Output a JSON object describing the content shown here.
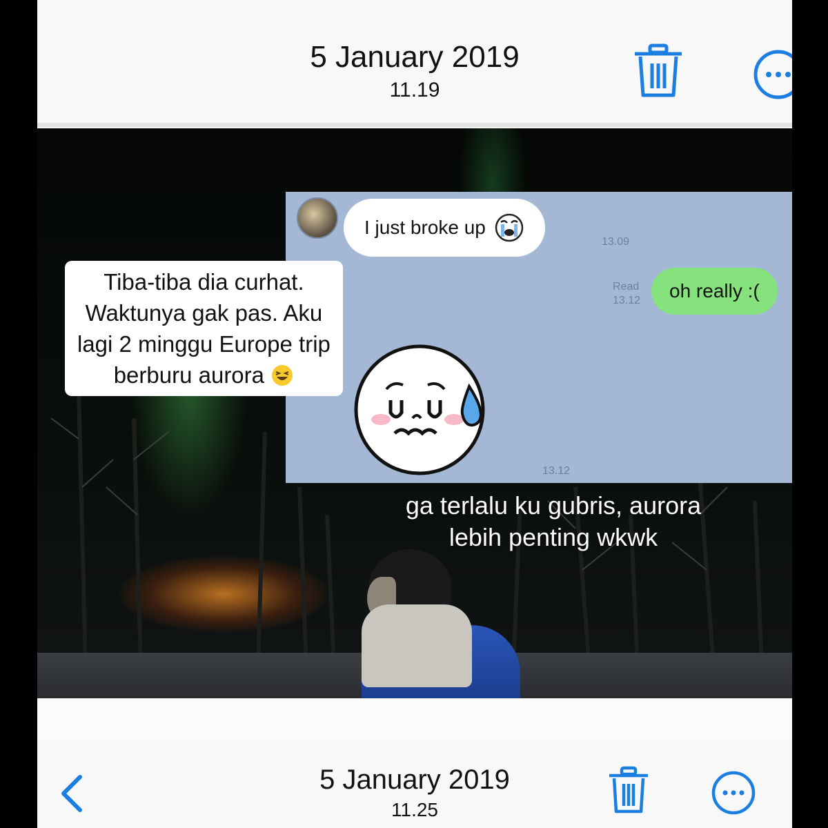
{
  "top_header": {
    "date": "5 January 2019",
    "time": "11.19"
  },
  "chat": {
    "incoming_message": "I just broke up",
    "incoming_time": "13.09",
    "read_label": "Read",
    "read_time": "13.12",
    "outgoing_message": "oh really :(",
    "sticker_time": "13.12"
  },
  "captions": {
    "left_line1": "Tiba-tiba dia curhat.",
    "left_line2": "Waktunya gak pas. Aku",
    "left_line3": "lagi 2 minggu Europe trip",
    "left_line4": "berburu aurora",
    "bottom_line1": "ga terlalu ku gubris, aurora",
    "bottom_line2": "lebih penting wkwk"
  },
  "bottom_bar": {
    "date": "5 January 2019",
    "time": "11.25"
  },
  "icons": {
    "trash": "trash-icon",
    "more": "more-icon",
    "back": "chevron-left-icon",
    "accent": "#1a7fe0"
  }
}
